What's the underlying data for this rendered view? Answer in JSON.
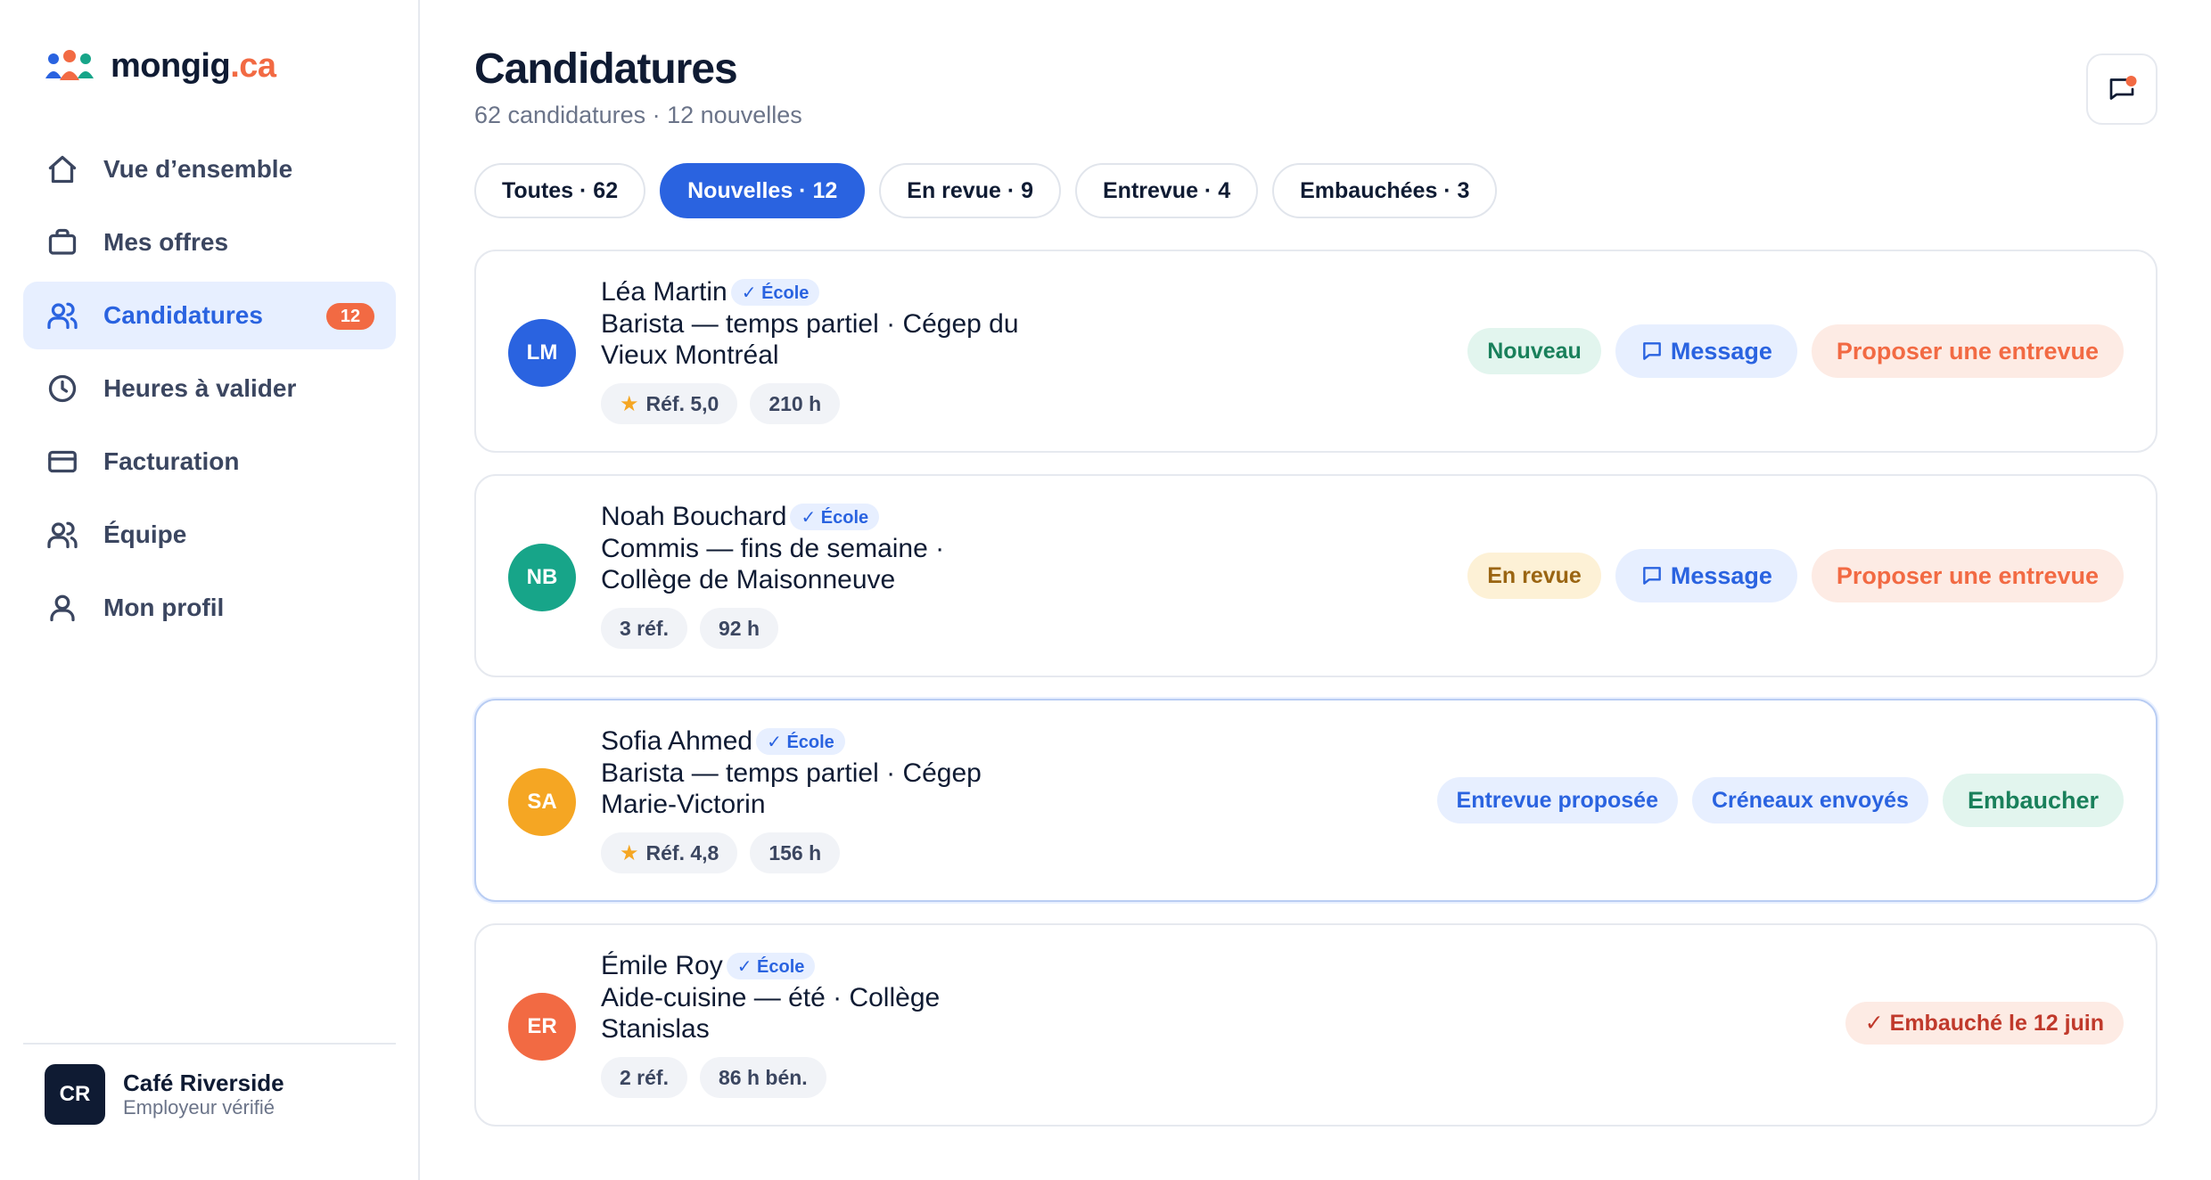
{
  "brand": {
    "name": "mongig",
    "tld": ".ca"
  },
  "sidebar": {
    "items": [
      {
        "label": "Vue d’ensemble",
        "icon": "home-icon"
      },
      {
        "label": "Mes offres",
        "icon": "briefcase-icon"
      },
      {
        "label": "Candidatures",
        "icon": "users-icon",
        "badge": "12",
        "active": true
      },
      {
        "label": "Heures à valider",
        "icon": "clock-icon"
      },
      {
        "label": "Facturation",
        "icon": "credit-card-icon"
      },
      {
        "label": "Équipe",
        "icon": "team-icon"
      },
      {
        "label": "Mon profil",
        "icon": "user-icon"
      }
    ],
    "employer": {
      "initials": "CR",
      "name": "Café Riverside",
      "status": "Employeur vérifié"
    }
  },
  "header": {
    "title": "Candidatures",
    "subtitle": "62 candidatures · 12 nouvelles"
  },
  "filters": [
    {
      "label": "Toutes · 62"
    },
    {
      "label": "Nouvelles · 12",
      "active": true
    },
    {
      "label": "En revue · 9"
    },
    {
      "label": "Entrevue · 4"
    },
    {
      "label": "Embauchées · 3"
    }
  ],
  "applications": [
    {
      "initials": "LM",
      "color": "#2a63e0",
      "name": "Léa Martin",
      "school_badge": "✓ École",
      "role_line1": "Barista — temps partiel · Cégep du",
      "role_line2": "Vieux Montréal",
      "tags": [
        "Réf. 5,0",
        "210 h"
      ],
      "star_on_first": true,
      "status": "Nouveau",
      "message": "Message",
      "cta": "Proposer une entrevue"
    },
    {
      "initials": "NB",
      "color": "#17a589",
      "name": "Noah Bouchard",
      "school_badge": "✓ École",
      "role_line1": "Commis — fins de semaine ·",
      "role_line2": "Collège de Maisonneuve",
      "tags": [
        "3 réf.",
        "92 h"
      ],
      "star_on_first": false,
      "status": "En revue",
      "message": "Message",
      "cta": "Proposer une entrevue"
    },
    {
      "initials": "SA",
      "color": "#f5a623",
      "name": "Sofia Ahmed",
      "school_badge": "✓ École",
      "role_line1": "Barista — temps partiel · Cégep",
      "role_line2": "Marie-Victorin",
      "tags": [
        "Réf. 4,8",
        "156 h"
      ],
      "star_on_first": true,
      "interview": "Entrevue proposée",
      "slots": "Créneaux envoyés",
      "hire": "Embaucher"
    },
    {
      "initials": "ER",
      "color": "#f26a43",
      "name": "Émile Roy",
      "school_badge": "✓ École",
      "role_line1": "Aide-cuisine — été · Collège",
      "role_line2": "Stanislas",
      "tags": [
        "2 réf.",
        "86 h bén."
      ],
      "star_on_first": false,
      "hired": "✓ Embauché le 12 juin"
    }
  ]
}
